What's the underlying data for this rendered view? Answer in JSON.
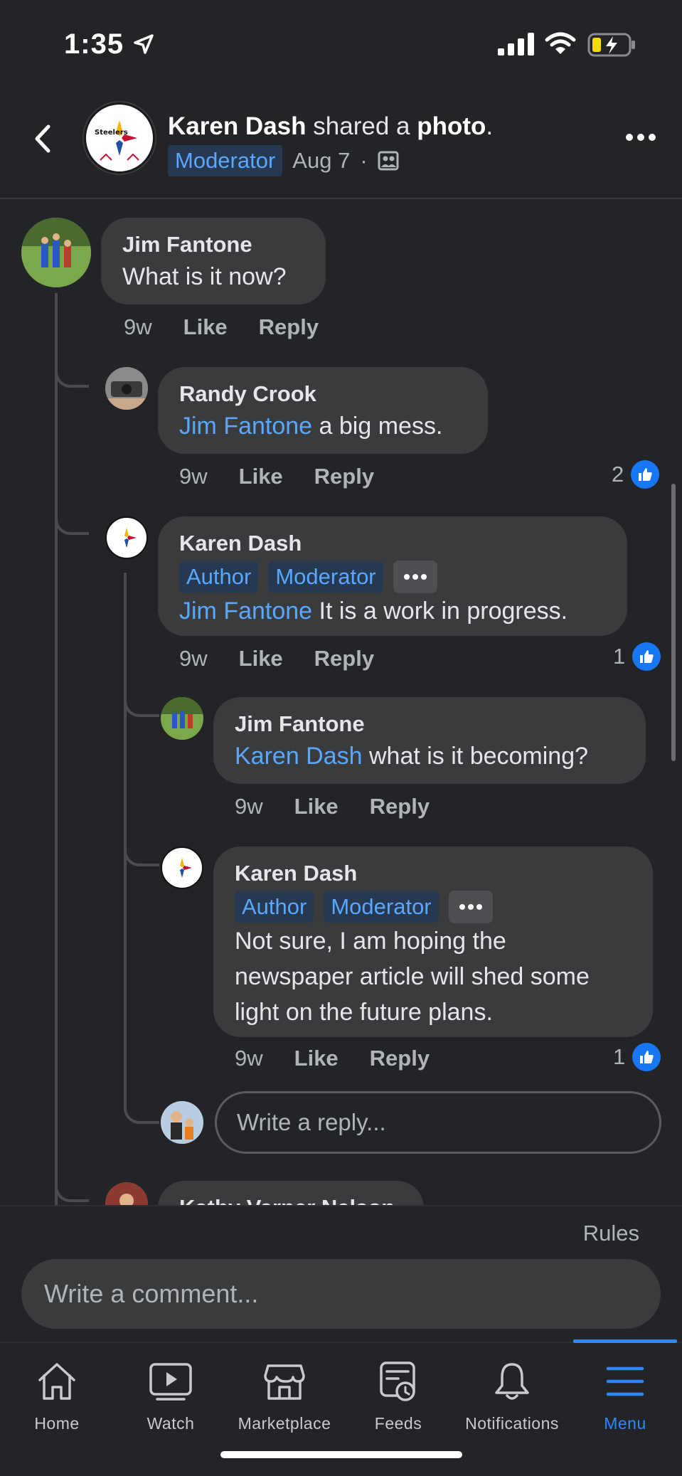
{
  "status_bar": {
    "time": "1:35"
  },
  "header": {
    "author": "Karen Dash",
    "action": "shared a",
    "object": "photo",
    "punct": ".",
    "role_badge": "Moderator",
    "date": "Aug 7",
    "separator": "·"
  },
  "comments": [
    {
      "name": "Jim Fantone",
      "text": "What is it now?",
      "time": "9w",
      "like_label": "Like",
      "reply_label": "Reply"
    },
    {
      "name": "Randy Crook",
      "mention": "Jim Fantone",
      "text": " a big mess.",
      "time": "9w",
      "like_label": "Like",
      "reply_label": "Reply",
      "reactions": "2"
    },
    {
      "name": "Karen Dash",
      "badges": [
        "Author",
        "Moderator"
      ],
      "mention": "Jim Fantone",
      "text": " It is a work in progress.",
      "time": "9w",
      "like_label": "Like",
      "reply_label": "Reply",
      "reactions": "1"
    },
    {
      "name": "Jim Fantone",
      "mention": "Karen Dash",
      "text": " what is it becoming?",
      "time": "9w",
      "like_label": "Like",
      "reply_label": "Reply"
    },
    {
      "name": "Karen Dash",
      "badges": [
        "Author",
        "Moderator"
      ],
      "text_lines": [
        "Not sure, I am hoping the",
        "newspaper article will shed some",
        "light on the future plans."
      ],
      "time": "9w",
      "like_label": "Like",
      "reply_label": "Reply",
      "reactions": "1"
    },
    {
      "name": "Kathy Varner Nelson"
    }
  ],
  "reply_input": {
    "placeholder": "Write a reply..."
  },
  "composer": {
    "rules_label": "Rules",
    "placeholder": "Write a comment..."
  },
  "tabs": [
    {
      "label": "Home",
      "icon": "home-icon"
    },
    {
      "label": "Watch",
      "icon": "watch-icon"
    },
    {
      "label": "Marketplace",
      "icon": "marketplace-icon"
    },
    {
      "label": "Feeds",
      "icon": "feeds-icon"
    },
    {
      "label": "Notifications",
      "icon": "bell-icon"
    },
    {
      "label": "Menu",
      "icon": "menu-icon",
      "active": true
    }
  ],
  "colors": {
    "accent": "#2d88ff",
    "mention": "#5aa7ff",
    "bubble": "#3a3b3d",
    "background": "#232427"
  }
}
